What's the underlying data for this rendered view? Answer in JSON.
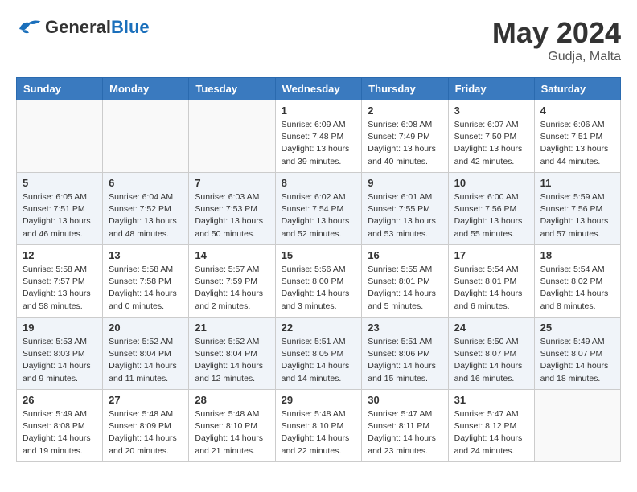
{
  "header": {
    "logo_general": "General",
    "logo_blue": "Blue",
    "month_year": "May 2024",
    "location": "Gudja, Malta"
  },
  "days_of_week": [
    "Sunday",
    "Monday",
    "Tuesday",
    "Wednesday",
    "Thursday",
    "Friday",
    "Saturday"
  ],
  "weeks": [
    [
      {
        "day": "",
        "info": ""
      },
      {
        "day": "",
        "info": ""
      },
      {
        "day": "",
        "info": ""
      },
      {
        "day": "1",
        "info": "Sunrise: 6:09 AM\nSunset: 7:48 PM\nDaylight: 13 hours\nand 39 minutes."
      },
      {
        "day": "2",
        "info": "Sunrise: 6:08 AM\nSunset: 7:49 PM\nDaylight: 13 hours\nand 40 minutes."
      },
      {
        "day": "3",
        "info": "Sunrise: 6:07 AM\nSunset: 7:50 PM\nDaylight: 13 hours\nand 42 minutes."
      },
      {
        "day": "4",
        "info": "Sunrise: 6:06 AM\nSunset: 7:51 PM\nDaylight: 13 hours\nand 44 minutes."
      }
    ],
    [
      {
        "day": "5",
        "info": "Sunrise: 6:05 AM\nSunset: 7:51 PM\nDaylight: 13 hours\nand 46 minutes."
      },
      {
        "day": "6",
        "info": "Sunrise: 6:04 AM\nSunset: 7:52 PM\nDaylight: 13 hours\nand 48 minutes."
      },
      {
        "day": "7",
        "info": "Sunrise: 6:03 AM\nSunset: 7:53 PM\nDaylight: 13 hours\nand 50 minutes."
      },
      {
        "day": "8",
        "info": "Sunrise: 6:02 AM\nSunset: 7:54 PM\nDaylight: 13 hours\nand 52 minutes."
      },
      {
        "day": "9",
        "info": "Sunrise: 6:01 AM\nSunset: 7:55 PM\nDaylight: 13 hours\nand 53 minutes."
      },
      {
        "day": "10",
        "info": "Sunrise: 6:00 AM\nSunset: 7:56 PM\nDaylight: 13 hours\nand 55 minutes."
      },
      {
        "day": "11",
        "info": "Sunrise: 5:59 AM\nSunset: 7:56 PM\nDaylight: 13 hours\nand 57 minutes."
      }
    ],
    [
      {
        "day": "12",
        "info": "Sunrise: 5:58 AM\nSunset: 7:57 PM\nDaylight: 13 hours\nand 58 minutes."
      },
      {
        "day": "13",
        "info": "Sunrise: 5:58 AM\nSunset: 7:58 PM\nDaylight: 14 hours\nand 0 minutes."
      },
      {
        "day": "14",
        "info": "Sunrise: 5:57 AM\nSunset: 7:59 PM\nDaylight: 14 hours\nand 2 minutes."
      },
      {
        "day": "15",
        "info": "Sunrise: 5:56 AM\nSunset: 8:00 PM\nDaylight: 14 hours\nand 3 minutes."
      },
      {
        "day": "16",
        "info": "Sunrise: 5:55 AM\nSunset: 8:01 PM\nDaylight: 14 hours\nand 5 minutes."
      },
      {
        "day": "17",
        "info": "Sunrise: 5:54 AM\nSunset: 8:01 PM\nDaylight: 14 hours\nand 6 minutes."
      },
      {
        "day": "18",
        "info": "Sunrise: 5:54 AM\nSunset: 8:02 PM\nDaylight: 14 hours\nand 8 minutes."
      }
    ],
    [
      {
        "day": "19",
        "info": "Sunrise: 5:53 AM\nSunset: 8:03 PM\nDaylight: 14 hours\nand 9 minutes."
      },
      {
        "day": "20",
        "info": "Sunrise: 5:52 AM\nSunset: 8:04 PM\nDaylight: 14 hours\nand 11 minutes."
      },
      {
        "day": "21",
        "info": "Sunrise: 5:52 AM\nSunset: 8:04 PM\nDaylight: 14 hours\nand 12 minutes."
      },
      {
        "day": "22",
        "info": "Sunrise: 5:51 AM\nSunset: 8:05 PM\nDaylight: 14 hours\nand 14 minutes."
      },
      {
        "day": "23",
        "info": "Sunrise: 5:51 AM\nSunset: 8:06 PM\nDaylight: 14 hours\nand 15 minutes."
      },
      {
        "day": "24",
        "info": "Sunrise: 5:50 AM\nSunset: 8:07 PM\nDaylight: 14 hours\nand 16 minutes."
      },
      {
        "day": "25",
        "info": "Sunrise: 5:49 AM\nSunset: 8:07 PM\nDaylight: 14 hours\nand 18 minutes."
      }
    ],
    [
      {
        "day": "26",
        "info": "Sunrise: 5:49 AM\nSunset: 8:08 PM\nDaylight: 14 hours\nand 19 minutes."
      },
      {
        "day": "27",
        "info": "Sunrise: 5:48 AM\nSunset: 8:09 PM\nDaylight: 14 hours\nand 20 minutes."
      },
      {
        "day": "28",
        "info": "Sunrise: 5:48 AM\nSunset: 8:10 PM\nDaylight: 14 hours\nand 21 minutes."
      },
      {
        "day": "29",
        "info": "Sunrise: 5:48 AM\nSunset: 8:10 PM\nDaylight: 14 hours\nand 22 minutes."
      },
      {
        "day": "30",
        "info": "Sunrise: 5:47 AM\nSunset: 8:11 PM\nDaylight: 14 hours\nand 23 minutes."
      },
      {
        "day": "31",
        "info": "Sunrise: 5:47 AM\nSunset: 8:12 PM\nDaylight: 14 hours\nand 24 minutes."
      },
      {
        "day": "",
        "info": ""
      }
    ]
  ]
}
